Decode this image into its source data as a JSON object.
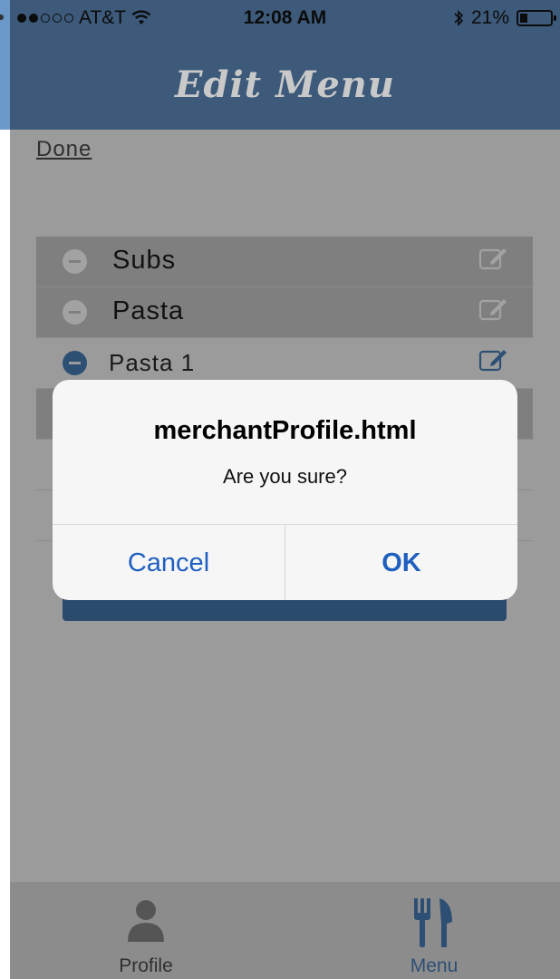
{
  "status_bar": {
    "carrier": "AT&T",
    "time": "12:08 AM",
    "battery": "21%",
    "signal_bars_filled": 2,
    "signal_bars_total": 5,
    "battery_level": 0.21
  },
  "nav": {
    "title": "Edit Menu"
  },
  "toolbar": {
    "done_label": "Done"
  },
  "menu_rows": [
    {
      "label": "Subs",
      "kind": "category",
      "icon": "minus-circle-icon"
    },
    {
      "label": "Pasta",
      "kind": "category",
      "icon": "minus-circle-icon"
    },
    {
      "label": "Pasta 1",
      "kind": "item",
      "icon": "minus-circle-icon"
    }
  ],
  "dialog": {
    "title": "merchantProfile.html",
    "message": "Are you sure?",
    "cancel_label": "Cancel",
    "ok_label": "OK"
  },
  "tabs": [
    {
      "label": "Profile",
      "icon": "person-icon",
      "active": false
    },
    {
      "label": "Menu",
      "icon": "fork-knife-icon",
      "active": true
    }
  ],
  "colors": {
    "header": "#3d5a7a",
    "accent": "#2e4f74",
    "dialog_button": "#1f5fbf"
  }
}
